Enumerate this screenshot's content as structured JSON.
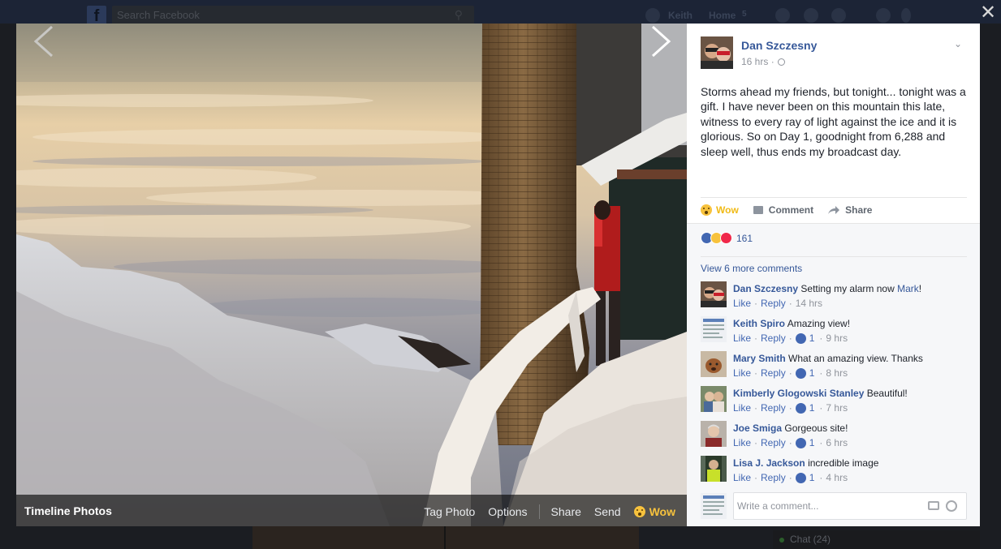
{
  "background": {
    "search_placeholder": "Search Facebook",
    "nav_user": "Keith",
    "nav_home": "Home",
    "nav_home_count": "5",
    "chat_label": "Chat (24)"
  },
  "viewer": {
    "album_title": "Timeline Photos",
    "actions": {
      "tag_photo": "Tag Photo",
      "options": "Options",
      "share": "Share",
      "send": "Send",
      "wow": "Wow"
    }
  },
  "post": {
    "author": "Dan Szczesny",
    "time": "16 hrs",
    "text": "Storms ahead my friends, but tonight... tonight was a gift. I have never been on this mountain this late, witness to every ray of light against the ice and it is glorious. So on Day 1, goodnight from 6,288 and sleep well, thus ends my broadcast day.",
    "actions": {
      "wow": "Wow",
      "comment": "Comment",
      "share": "Share"
    },
    "reaction_count": "161",
    "view_more": "View 6 more comments"
  },
  "comments": [
    {
      "name": "Dan Szczesny",
      "text": "Setting my alarm now ",
      "mention": "Mark",
      "end": "!",
      "like": "Like",
      "reply": "Reply",
      "likes": "",
      "time": "14 hrs"
    },
    {
      "name": "Keith Spiro",
      "text": "Amazing view!",
      "like": "Like",
      "reply": "Reply",
      "likes": "1",
      "time": "9 hrs"
    },
    {
      "name": "Mary Smith",
      "text": "What an amazing view. Thanks",
      "like": "Like",
      "reply": "Reply",
      "likes": "1",
      "time": "8 hrs"
    },
    {
      "name": "Kimberly Glogowski Stanley",
      "text": "Beautiful!",
      "like": "Like",
      "reply": "Reply",
      "likes": "1",
      "time": "7 hrs"
    },
    {
      "name": "Joe Smiga",
      "text": "Gorgeous site!",
      "like": "Like",
      "reply": "Reply",
      "likes": "1",
      "time": "6 hrs"
    },
    {
      "name": "Lisa J. Jackson",
      "text": "incredible image",
      "like": "Like",
      "reply": "Reply",
      "likes": "1",
      "time": "4 hrs"
    }
  ],
  "composer": {
    "placeholder": "Write a comment..."
  },
  "colors": {
    "link": "#365899",
    "wow": "#f0ba15",
    "like_blue": "#4267b2",
    "love_red": "#f0284a"
  },
  "icons": [
    "search-icon",
    "close-icon",
    "chevron-left-icon",
    "chevron-right-icon",
    "wow-icon",
    "comment-icon",
    "share-icon",
    "globe-icon",
    "chevron-down-icon",
    "like-icon",
    "love-icon",
    "camera-icon",
    "smile-icon"
  ]
}
